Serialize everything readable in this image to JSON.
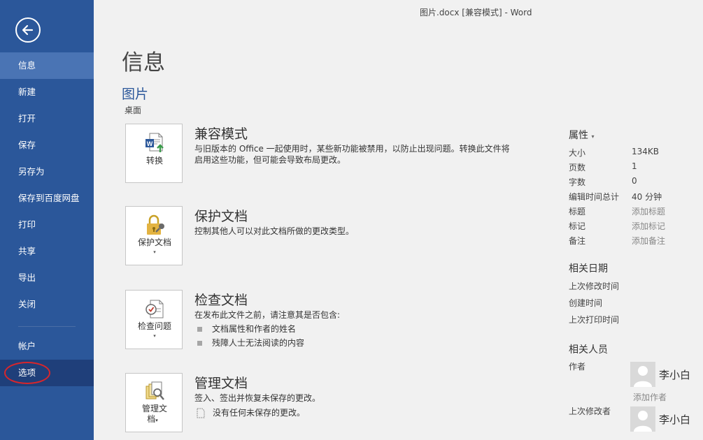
{
  "window": {
    "title": "图片.docx [兼容模式] - Word"
  },
  "sidebar": {
    "items": [
      {
        "label": "信息"
      },
      {
        "label": "新建"
      },
      {
        "label": "打开"
      },
      {
        "label": "保存"
      },
      {
        "label": "另存为"
      },
      {
        "label": "保存到百度网盘"
      },
      {
        "label": "打印"
      },
      {
        "label": "共享"
      },
      {
        "label": "导出"
      },
      {
        "label": "关闭"
      },
      {
        "label": "帐户"
      },
      {
        "label": "选项"
      }
    ]
  },
  "main": {
    "page_title": "信息",
    "doc_name": "图片",
    "doc_location": "桌面",
    "sections": [
      {
        "tile_label": "转换",
        "title": "兼容模式",
        "description": "与旧版本的 Office 一起使用时，某些新功能被禁用，以防止出现问题。转换此文件将启用这些功能，但可能会导致布局更改。"
      },
      {
        "tile_label": "保护文档",
        "title": "保护文档",
        "description": "控制其他人可以对此文档所做的更改类型。"
      },
      {
        "tile_label": "检查问题",
        "title": "检查文档",
        "description": "在发布此文件之前，请注意其是否包含:",
        "bullets": [
          "文档属性和作者的姓名",
          "残障人士无法阅读的内容"
        ]
      },
      {
        "tile_label_line1": "管理文",
        "tile_label_line2": "档",
        "title": "管理文档",
        "description": "签入、签出并恢复未保存的更改。",
        "note": "没有任何未保存的更改。"
      }
    ]
  },
  "properties": {
    "header": "属性",
    "rows": [
      {
        "label": "大小",
        "value": "134KB"
      },
      {
        "label": "页数",
        "value": "1"
      },
      {
        "label": "字数",
        "value": "0"
      },
      {
        "label": "编辑时间总计",
        "value": "40 分钟"
      },
      {
        "label": "标题",
        "value": "添加标题"
      },
      {
        "label": "标记",
        "value": "添加标记"
      },
      {
        "label": "备注",
        "value": "添加备注"
      }
    ]
  },
  "related_dates": {
    "header": "相关日期",
    "labels": [
      "上次修改时间",
      "创建时间",
      "上次打印时间"
    ]
  },
  "related_people": {
    "header": "相关人员",
    "author_label": "作者",
    "author_name": "李小白",
    "add_author": "添加作者",
    "last_modified_label": "上次修改者",
    "last_modified_name": "李小白"
  },
  "colors": {
    "sidebar": "#2b579a",
    "sidebar_active": "#4a74b4",
    "accent": "#2b579a",
    "highlight_circle": "#d9262b"
  }
}
